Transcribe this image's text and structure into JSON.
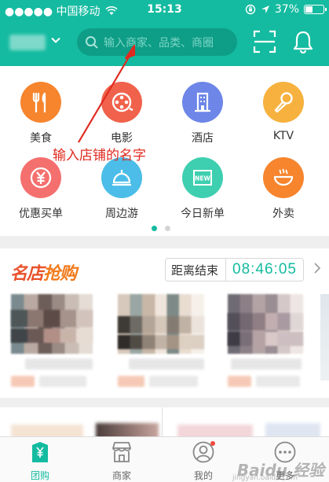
{
  "status_bar": {
    "carrier": "●●●●● 中国移动",
    "time": "15:13",
    "battery": "37%"
  },
  "header": {
    "search_placeholder": "输入商家、品类、商圈"
  },
  "categories": [
    {
      "label": "美食",
      "icon": "fork-knife-icon",
      "color": "#f6852e"
    },
    {
      "label": "电影",
      "icon": "film-reel-icon",
      "color": "#f0624b"
    },
    {
      "label": "酒店",
      "icon": "hotel-building-icon",
      "color": "#6d86e8"
    },
    {
      "label": "KTV",
      "icon": "microphone-icon",
      "color": "#f6b13e"
    },
    {
      "label": "优惠买单",
      "icon": "yuan-coin-icon",
      "color": "#f4706f"
    },
    {
      "label": "周边游",
      "icon": "travel-bag-icon",
      "color": "#4bbde8"
    },
    {
      "label": "今日新单",
      "icon": "new-badge-icon",
      "color": "#3ecfb0"
    },
    {
      "label": "外卖",
      "icon": "bowl-icon",
      "color": "#f6852e"
    }
  ],
  "annotation": {
    "text": "输入店铺的名字"
  },
  "flash_sale": {
    "title_part1": "名店",
    "title_part2": "抢购",
    "countdown_label": "距离结束",
    "countdown_time": "08:46:05"
  },
  "tabs": [
    {
      "label": "团购",
      "icon": "tuangou-tag-icon",
      "active": true
    },
    {
      "label": "商家",
      "icon": "storefront-icon",
      "active": false
    },
    {
      "label": "我的",
      "icon": "user-profile-icon",
      "active": false
    },
    {
      "label": "更多",
      "icon": "more-dots-icon",
      "active": false
    }
  ],
  "watermark": {
    "text": "Baidu 经验",
    "sub": "jingyan.baidu.com"
  },
  "colors": {
    "brand": "#14bba0",
    "search_bg": "#0e9d86",
    "annotation": "#e02a1f"
  }
}
